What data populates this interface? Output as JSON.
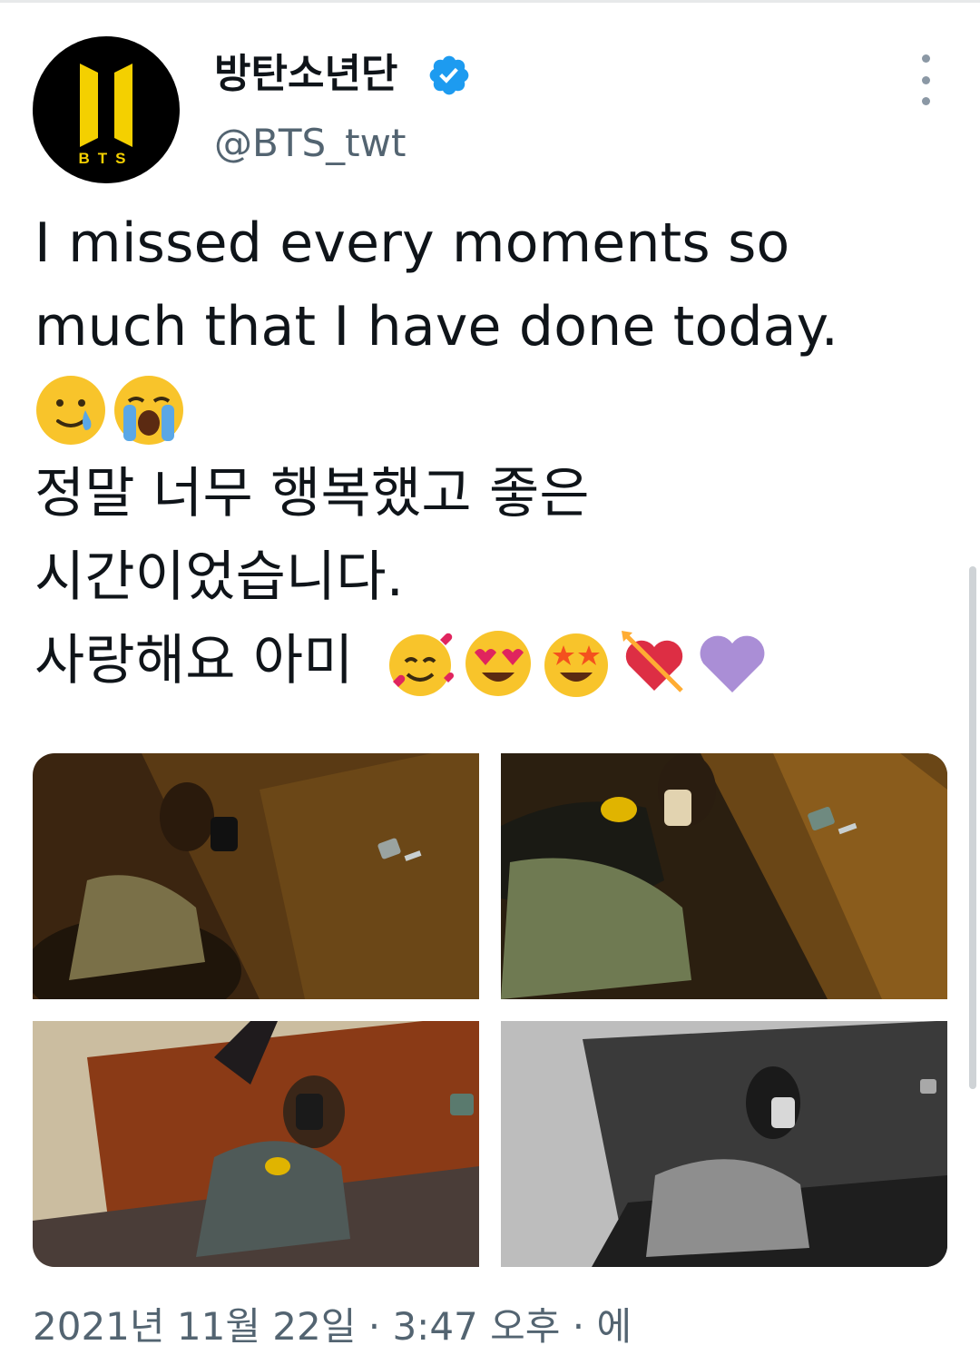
{
  "account": {
    "display_name": "방탄소년단",
    "handle": "@BTS_twt",
    "verified": true,
    "avatar_label": "BTS",
    "avatar_colors": {
      "background": "#000000",
      "logo": "#f4d000"
    }
  },
  "tweet": {
    "lines": [
      "I missed every moments so",
      "much that I have done today.",
      "정말 너무 행복했고 좋은",
      "시간이었습니다.",
      "사랑해요 아미"
    ],
    "emoji_row_1": [
      "face-holding-back-tears",
      "loudly-crying-face"
    ],
    "emoji_row_2": [
      "smiling-face-with-hearts",
      "heart-eyes-face",
      "star-struck-face",
      "heart-with-arrow",
      "purple-heart"
    ]
  },
  "media": {
    "photos": [
      {
        "name": "photo-1",
        "tone": "warm-dark"
      },
      {
        "name": "photo-2",
        "tone": "warm-dark"
      },
      {
        "name": "photo-3",
        "tone": "warm-bright"
      },
      {
        "name": "photo-4",
        "tone": "grayscale"
      }
    ]
  },
  "timestamp": "2021년 11월 22일 · 3:47 오후 · 에",
  "colors": {
    "verified": "#1d9bf0",
    "secondary_text": "#536471"
  }
}
